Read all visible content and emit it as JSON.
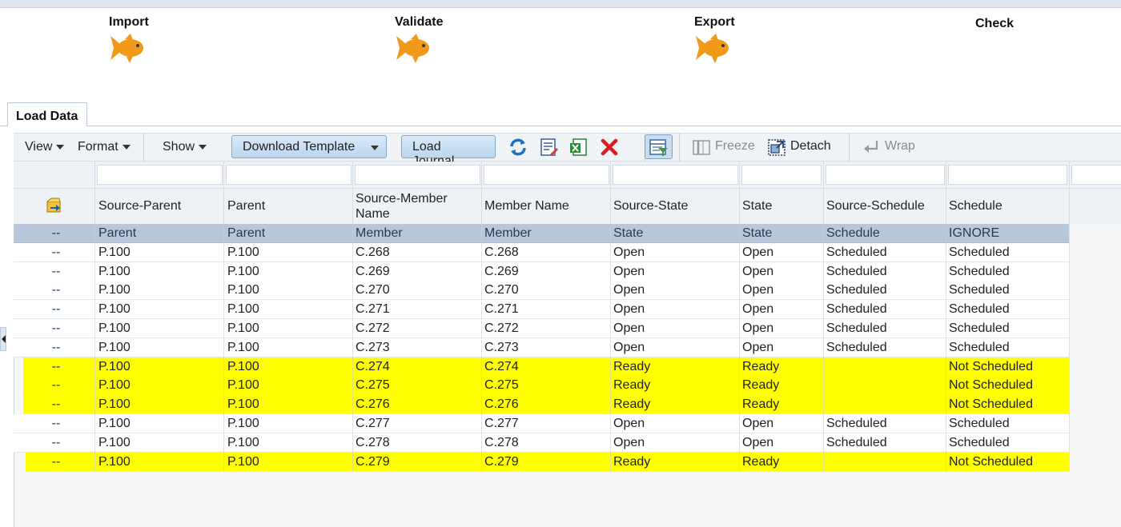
{
  "steps": [
    {
      "label": "Import",
      "icon": "fish-icon"
    },
    {
      "label": "Validate",
      "icon": "fish-icon"
    },
    {
      "label": "Export",
      "icon": "fish-icon"
    },
    {
      "label": "Check"
    }
  ],
  "tab": {
    "label": "Load Data"
  },
  "toolbar": {
    "view": "View",
    "format": "Format",
    "show": "Show",
    "download_template": "Download Template",
    "load_journal": "Load Journal",
    "freeze": "Freeze",
    "detach": "Detach",
    "wrap": "Wrap"
  },
  "colors": {
    "highlight": "#ffff00",
    "accent_icon": "#f19a1a",
    "header_row": "#b8c8da"
  },
  "table": {
    "columns": [
      "Source-Parent",
      "Parent",
      "Source-Member Name",
      "Member Name",
      "Source-State",
      "State",
      "Source-Schedule",
      "Schedule"
    ],
    "rows": [
      {
        "marker": "--",
        "cells": [
          "Parent",
          "Parent",
          "Member",
          "Member",
          "State",
          "State",
          "Schedule",
          "IGNORE"
        ],
        "style": "gray"
      },
      {
        "marker": "--",
        "cells": [
          "P.100",
          "P.100",
          "C.268",
          "C.268",
          "Open",
          "Open",
          "Scheduled",
          "Scheduled"
        ],
        "style": ""
      },
      {
        "marker": "--",
        "cells": [
          "P.100",
          "P.100",
          "C.269",
          "C.269",
          "Open",
          "Open",
          "Scheduled",
          "Scheduled"
        ],
        "style": ""
      },
      {
        "marker": "--",
        "cells": [
          "P.100",
          "P.100",
          "C.270",
          "C.270",
          "Open",
          "Open",
          "Scheduled",
          "Scheduled"
        ],
        "style": ""
      },
      {
        "marker": "--",
        "cells": [
          "P.100",
          "P.100",
          "C.271",
          "C.271",
          "Open",
          "Open",
          "Scheduled",
          "Scheduled"
        ],
        "style": ""
      },
      {
        "marker": "--",
        "cells": [
          "P.100",
          "P.100",
          "C.272",
          "C.272",
          "Open",
          "Open",
          "Scheduled",
          "Scheduled"
        ],
        "style": ""
      },
      {
        "marker": "--",
        "cells": [
          "P.100",
          "P.100",
          "C.273",
          "C.273",
          "Open",
          "Open",
          "Scheduled",
          "Scheduled"
        ],
        "style": ""
      },
      {
        "marker": "--",
        "cells": [
          "P.100",
          "P.100",
          "C.274",
          "C.274",
          "Ready",
          "Ready",
          "",
          "Not Scheduled"
        ],
        "style": "hl"
      },
      {
        "marker": "--",
        "cells": [
          "P.100",
          "P.100",
          "C.275",
          "C.275",
          "Ready",
          "Ready",
          "",
          "Not Scheduled"
        ],
        "style": "hl"
      },
      {
        "marker": "--",
        "cells": [
          "P.100",
          "P.100",
          "C.276",
          "C.276",
          "Ready",
          "Ready",
          "",
          "Not Scheduled"
        ],
        "style": "hl"
      },
      {
        "marker": "--",
        "cells": [
          "P.100",
          "P.100",
          "C.277",
          "C.277",
          "Open",
          "Open",
          "Scheduled",
          "Scheduled"
        ],
        "style": ""
      },
      {
        "marker": "--",
        "cells": [
          "P.100",
          "P.100",
          "C.278",
          "C.278",
          "Open",
          "Open",
          "Scheduled",
          "Scheduled"
        ],
        "style": ""
      },
      {
        "marker": "--",
        "cells": [
          "P.100",
          "P.100",
          "C.279",
          "C.279",
          "Ready",
          "Ready",
          "",
          "Not Scheduled"
        ],
        "style": "hl"
      }
    ]
  }
}
